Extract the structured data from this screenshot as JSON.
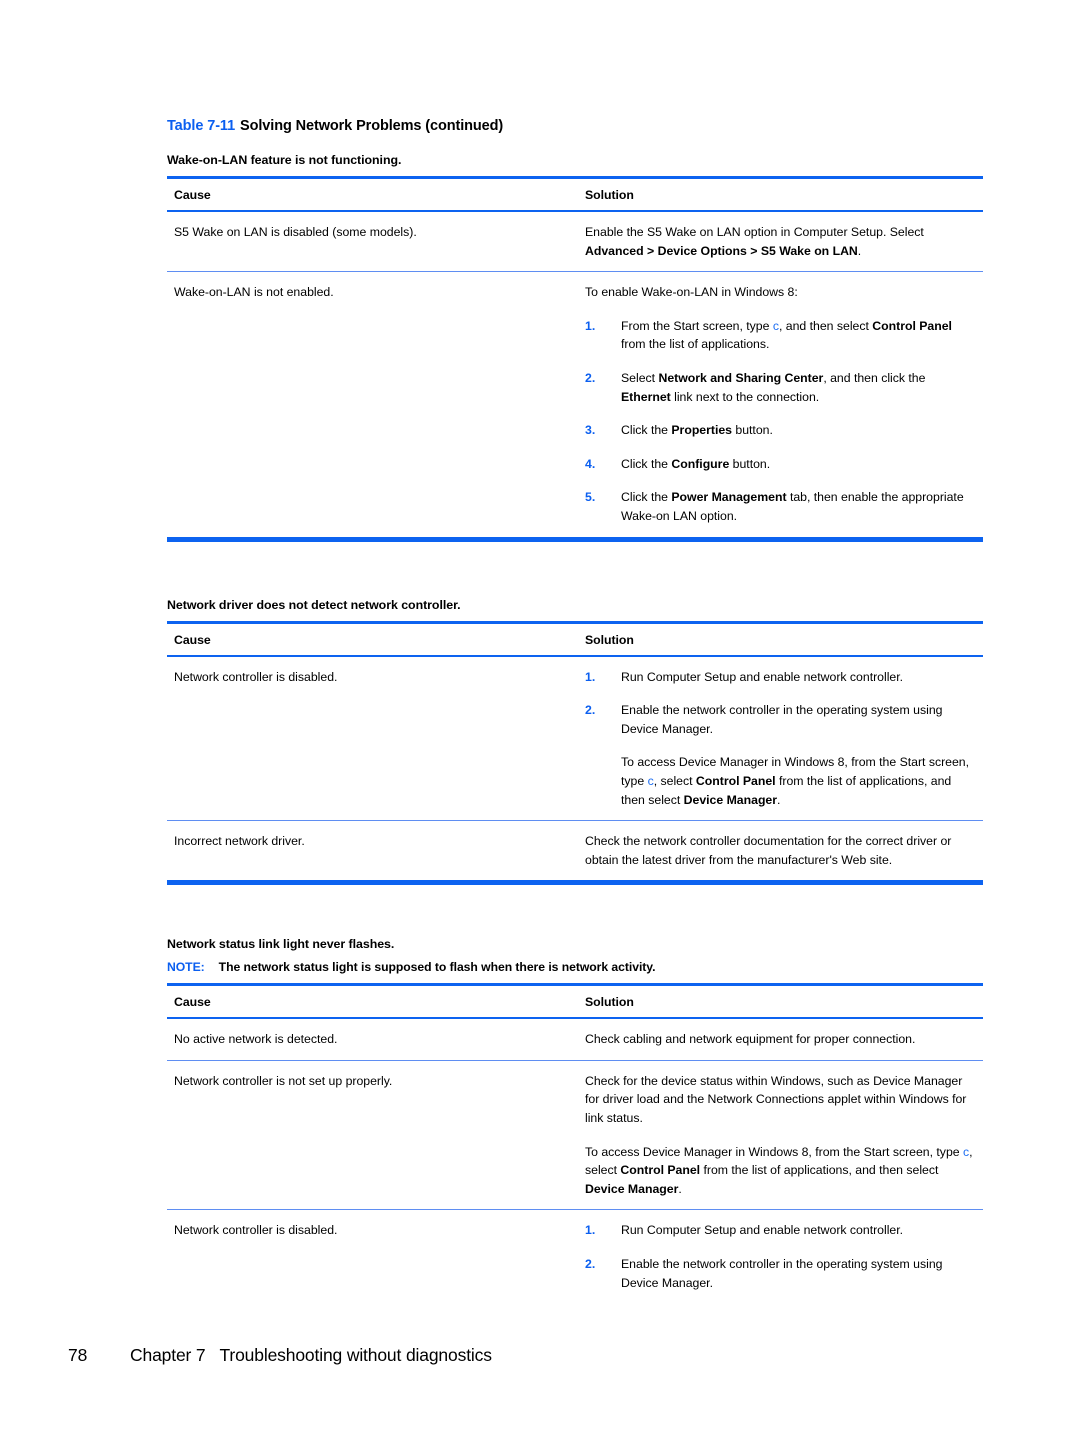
{
  "document": {
    "table_caption": {
      "number": "Table 7-11",
      "title": "Solving Network Problems (continued)"
    },
    "columns": {
      "cause": "Cause",
      "solution": "Solution"
    },
    "sections": [
      {
        "heading": "Wake-on-LAN feature is not functioning.",
        "rows": [
          {
            "cause": "S5 Wake on LAN is disabled (some models).",
            "solution_intro": "Enable the S5 Wake on LAN option in Computer Setup. Select",
            "solution_bold_path": "Advanced > Device Options > S5 Wake on LAN."
          },
          {
            "cause": "Wake-on-LAN is not enabled.",
            "solution_intro": "To enable Wake-on-LAN in Windows 8:",
            "steps": [
              {
                "num": "1.",
                "text": "From the Start screen, type c, and then select Control Panel from the list of applications."
              },
              {
                "num": "2.",
                "text": "Select Network and Sharing Center, and then click the Ethernet link next to the connection."
              },
              {
                "num": "3.",
                "text": "Click the Properties button."
              },
              {
                "num": "4.",
                "text": "Click the Configure button."
              },
              {
                "num": "5.",
                "text": "Click the Power Management tab, then enable the appropriate Wake-on LAN option."
              }
            ]
          }
        ]
      },
      {
        "heading": "Network driver does not detect network controller.",
        "rows": [
          {
            "cause": "Network controller is disabled.",
            "steps": [
              {
                "num": "1.",
                "text": "Run Computer Setup and enable network controller."
              },
              {
                "num": "2.",
                "text": "Enable the network controller in the operating system using Device Manager.",
                "sub": "To access Device Manager in Windows 8, from the Start screen, type c, select Control Panel from the list of applications, and then select Device Manager."
              }
            ]
          },
          {
            "cause": "Incorrect network driver.",
            "solution_plain": "Check the network controller documentation for the correct driver or obtain the latest driver from the manufacturer's Web site."
          }
        ]
      },
      {
        "heading": "Network status link light never flashes.",
        "note": {
          "keyword": "NOTE:",
          "text": "The network status light is supposed to flash when there is network activity."
        },
        "rows": [
          {
            "cause": "No active network is detected.",
            "solution_plain": "Check cabling and network equipment for proper connection."
          },
          {
            "cause": "Network controller is not set up properly.",
            "solution_plain": "Check for the device status within Windows, such as Device Manager for driver load and the Network Connections applet within Windows for link status.",
            "solution_extra": "To access Device Manager in Windows 8, from the Start screen, type c, select Control Panel from the list of applications, and then select Device Manager."
          },
          {
            "cause": "Network controller is disabled.",
            "steps": [
              {
                "num": "1.",
                "text": "Run Computer Setup and enable network controller."
              },
              {
                "num": "2.",
                "text": "Enable the network controller in the operating system using Device Manager."
              }
            ]
          }
        ]
      }
    ]
  },
  "footer": {
    "page_number": "78",
    "chapter": "Chapter 7",
    "chapter_title": "Troubleshooting without diagnostics"
  },
  "colors": {
    "accent_blue": "#0d63f0",
    "rule_light_blue": "#5f8ef2",
    "keycap_blue": "#1f6ff2"
  }
}
